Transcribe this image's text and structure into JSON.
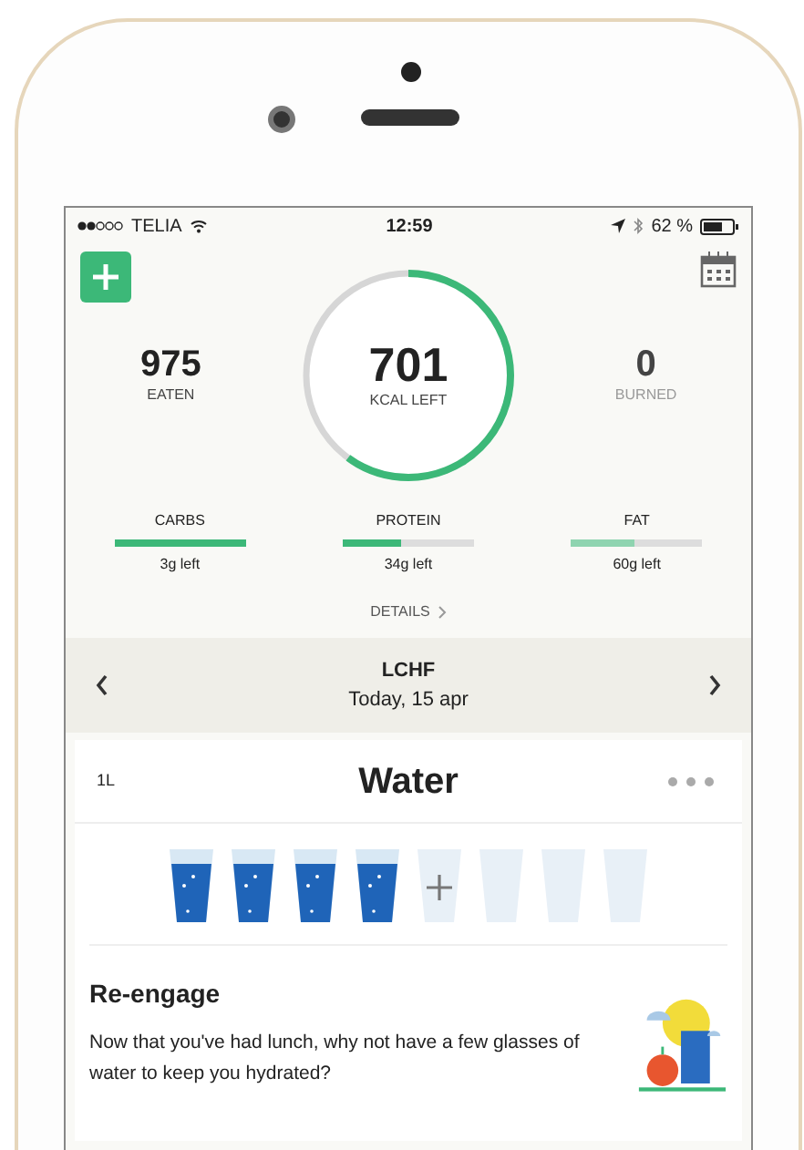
{
  "status_bar": {
    "carrier": "TELIA",
    "time": "12:59",
    "battery": "62 %"
  },
  "summary": {
    "eaten": {
      "value": "975",
      "label": "EATEN"
    },
    "kcal_left": {
      "value": "701",
      "label": "KCAL LEFT",
      "level": 0.6
    },
    "burned": {
      "value": "0",
      "label": "BURNED"
    }
  },
  "macros": [
    {
      "name": "CARBS",
      "level": 1.0,
      "reading": "3g left",
      "color": "#3cb878"
    },
    {
      "name": "PROTEIN",
      "level": 0.45,
      "reading": "34g left",
      "color": "#3cb878"
    },
    {
      "name": "FAT",
      "level": 0.48,
      "reading": "60g left",
      "color": "#8fd4b0"
    }
  ],
  "details": "DETAILS",
  "day": {
    "plan": "LCHF",
    "date": "Today, 15 apr"
  },
  "water": {
    "amount": "1L",
    "title": "Water",
    "glasses": [
      {
        "kind": "full"
      },
      {
        "kind": "full"
      },
      {
        "kind": "full"
      },
      {
        "kind": "full"
      },
      {
        "kind": "add"
      },
      {
        "kind": "empty"
      },
      {
        "kind": "empty"
      },
      {
        "kind": "empty"
      }
    ]
  },
  "tip": {
    "title": "Re-engage",
    "text": "Now that you've had lunch, why not have a few glasses of water to keep you hydrated?"
  }
}
